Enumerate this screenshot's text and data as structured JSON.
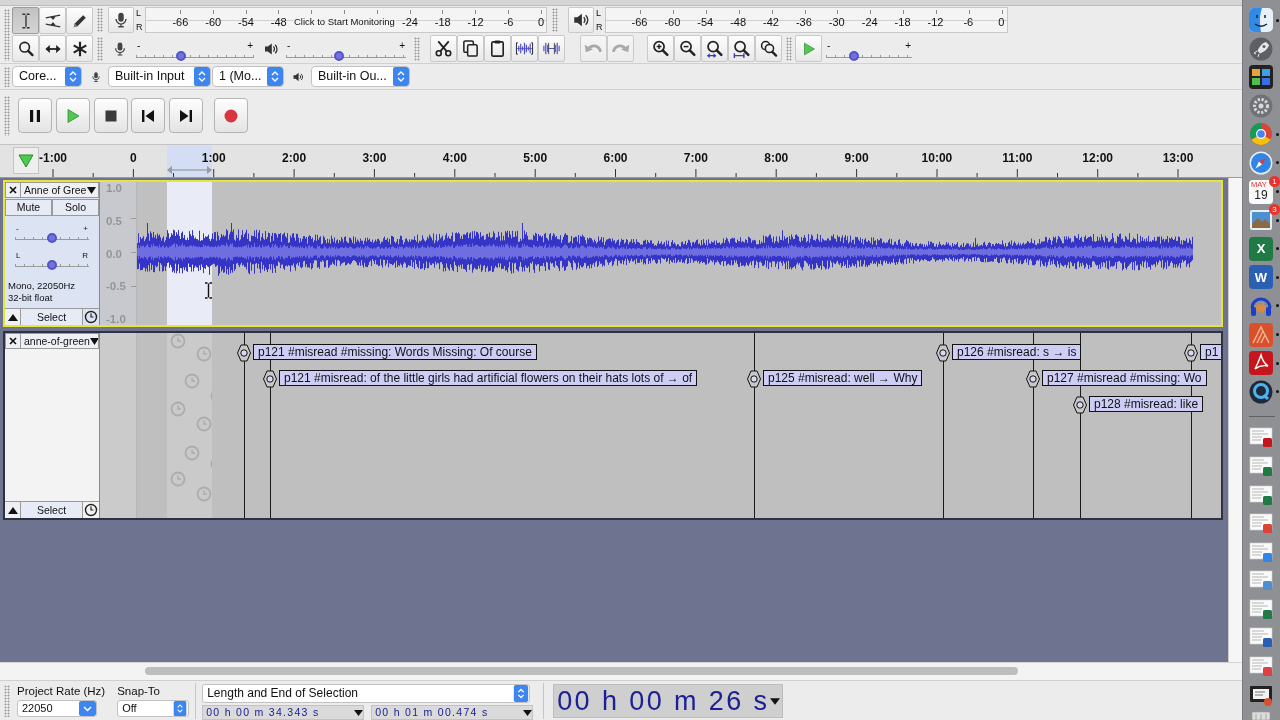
{
  "toolbars": {
    "tools": [
      {
        "kind": "ibeam",
        "selected": true
      },
      {
        "kind": "envelope",
        "selected": false
      },
      {
        "kind": "pencil",
        "selected": false
      },
      {
        "kind": "zoom",
        "selected": false
      },
      {
        "kind": "timeshift",
        "selected": false
      },
      {
        "kind": "multi",
        "selected": false
      }
    ],
    "record_meter": {
      "channels": [
        "L",
        "R"
      ],
      "scale_before": [
        "-66",
        "-60",
        "-54",
        "-48"
      ],
      "hint": "Click to Start Monitoring",
      "scale_after": [
        "-24",
        "-18",
        "-12",
        "-6",
        "0"
      ]
    },
    "playback_meter": {
      "channels": [
        "L",
        "R"
      ],
      "scale": [
        "-66",
        "-60",
        "-54",
        "-48",
        "-42",
        "-36",
        "-30",
        "-24",
        "-18",
        "-12",
        "-6",
        "0"
      ]
    },
    "mixer": {
      "input": {
        "min": "-",
        "max": "+",
        "level": 0.38
      },
      "output": {
        "min": "-",
        "max": "+",
        "level": 0.44
      }
    },
    "edit": [
      [
        {
          "kind": "cut",
          "disabled": false
        },
        {
          "kind": "copy",
          "disabled": false
        },
        {
          "kind": "paste",
          "disabled": false
        },
        {
          "kind": "trim",
          "disabled": false
        },
        {
          "kind": "silence",
          "disabled": false
        }
      ],
      [
        {
          "kind": "undo",
          "disabled": true
        },
        {
          "kind": "redo",
          "disabled": true
        }
      ],
      [
        {
          "kind": "zoom_in",
          "disabled": false
        },
        {
          "kind": "zoom_out",
          "disabled": false
        },
        {
          "kind": "fit_selection",
          "disabled": false
        },
        {
          "kind": "fit_project",
          "disabled": false
        },
        {
          "kind": "zoom_toggle",
          "disabled": false
        }
      ]
    ],
    "play_at_speed": {
      "min": "-",
      "max": "+",
      "level": 0.33
    },
    "device": {
      "host": "Core...",
      "input": "Built-in Input",
      "channels": "1 (Mo...",
      "output": "Built-in Ou..."
    },
    "transport": [
      {
        "kind": "pause"
      },
      {
        "kind": "play"
      },
      {
        "kind": "stop"
      },
      {
        "kind": "skip_start"
      },
      {
        "kind": "skip_end"
      },
      {
        "kind": "record"
      }
    ]
  },
  "timeline": {
    "ticks": [
      "-1:00",
      "0",
      "1:00",
      "2:00",
      "3:00",
      "4:00",
      "5:00",
      "6:00",
      "7:00",
      "8:00",
      "9:00",
      "10:00",
      "11:00",
      "12:00",
      "13:00"
    ]
  },
  "tracks": [
    {
      "kind": "audio",
      "selected": true,
      "focused": true,
      "name": "Anne of Gree",
      "mute": "Mute",
      "solo": "Solo",
      "gain": {
        "min": "-",
        "max": "+",
        "level": 0.5
      },
      "pan": {
        "min": "L",
        "max": "R",
        "level": 0.5
      },
      "info": [
        "Mono, 22050Hz",
        "32-bit float"
      ],
      "select": "Select",
      "scale": [
        "1.0",
        "0.5",
        "0.0",
        "-0.5",
        "-1.0"
      ]
    },
    {
      "kind": "label",
      "selected": false,
      "focused": false,
      "name": "anne-of-green",
      "select": "Select",
      "labels": [
        {
          "text": "p121 #misread #missing: Words Missing: Of course"
        },
        {
          "text": "p121 #misread: of the little girls had artificial flowers on their hats lots of → of"
        },
        {
          "text": "p125 #misread: well → Why"
        },
        {
          "text": "p126 #misread: s → is"
        },
        {
          "text": "p127 #misread #missing: Wo"
        },
        {
          "text": "p128 #misread: like"
        },
        {
          "text": "p1"
        }
      ]
    }
  ],
  "selection_toolbar": {
    "rate_label": "Project Rate (Hz)",
    "rate": "22050",
    "snap_label": "Snap-To",
    "snap": "Off",
    "format": "Length and End of Selection",
    "times": [
      "00 h 00 m 34.343 s",
      "00 h 01 m 00.474 s"
    ]
  },
  "audio_position": "00 h 00 m 26 s",
  "dock": [
    {
      "kind": "face",
      "running": true
    },
    {
      "kind": "rocket",
      "running": false
    },
    {
      "kind": "panels",
      "running": false
    },
    {
      "kind": "gear",
      "running": false
    },
    {
      "kind": "wheel",
      "running": true
    },
    {
      "kind": "compass",
      "running": true
    },
    {
      "kind": "calendar",
      "running": true,
      "month": "MAY",
      "day": "19",
      "badge": "1"
    },
    {
      "kind": "photo",
      "running": true,
      "badge": "3"
    },
    {
      "kind": "tile",
      "letter": "X",
      "color": "#1f7a45",
      "running": true
    },
    {
      "kind": "tile",
      "letter": "W",
      "color": "#2b5fb4",
      "running": true
    },
    {
      "kind": "headphones",
      "running": true
    },
    {
      "kind": "stripes",
      "running": true
    },
    {
      "kind": "swirl",
      "running": true
    },
    {
      "kind": "ring",
      "running": true
    }
  ],
  "dock_documents": [
    {
      "kind": "swirl"
    },
    {
      "kind": "sheet"
    },
    {
      "kind": "sheet"
    },
    {
      "kind": "wheel"
    },
    {
      "kind": "face"
    },
    {
      "kind": "photo"
    },
    {
      "kind": "sheet"
    },
    {
      "kind": "doc"
    },
    {
      "kind": "calendar"
    }
  ],
  "dock_end": [
    {
      "kind": "film"
    },
    {
      "kind": "trash"
    }
  ]
}
